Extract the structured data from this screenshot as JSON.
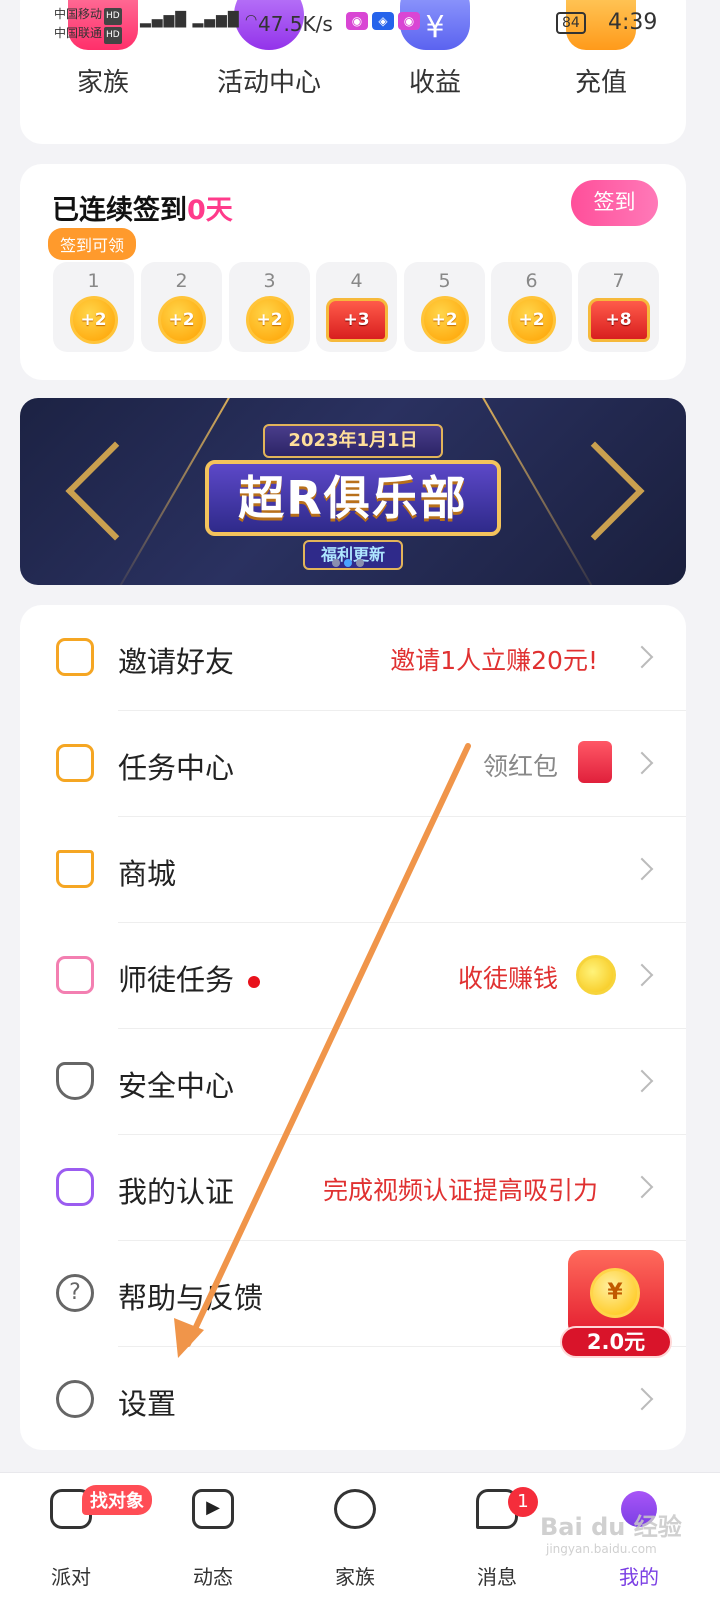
{
  "status_bar": {
    "carrier_1": "中国移动",
    "carrier_2": "中国联通",
    "hd_label": "HD",
    "net_speed": "47.5K/s",
    "battery": "84",
    "time": "4:39"
  },
  "quick_entries": [
    {
      "label": "家族",
      "icon": "family-icon",
      "color": "#ff4f7e"
    },
    {
      "label": "活动中心",
      "icon": "star-icon",
      "color": "#a855f7"
    },
    {
      "label": "收益",
      "icon": "money-bag-icon",
      "color": "#6d7cf6"
    },
    {
      "label": "充值",
      "icon": "lightning-icon",
      "color": "#ffa21a"
    }
  ],
  "checkin": {
    "title_prefix": "已连续签到",
    "days_value": "0天",
    "sign_button": "签到",
    "tip": "签到可领",
    "days": [
      {
        "num": "1",
        "reward": "+2",
        "kind": "coin"
      },
      {
        "num": "2",
        "reward": "+2",
        "kind": "coin"
      },
      {
        "num": "3",
        "reward": "+2",
        "kind": "coin"
      },
      {
        "num": "4",
        "reward": "+3",
        "kind": "chest"
      },
      {
        "num": "5",
        "reward": "+2",
        "kind": "coin"
      },
      {
        "num": "6",
        "reward": "+2",
        "kind": "coin"
      },
      {
        "num": "7",
        "reward": "+8",
        "kind": "chest"
      }
    ]
  },
  "banner": {
    "date": "2023年1月1日",
    "name": "超R俱乐部",
    "subtitle": "福利更新"
  },
  "menu": [
    {
      "label": "邀请好友",
      "right": "邀请1人立赚20元!",
      "icon": "gift-icon",
      "icon_color": "#f5a623"
    },
    {
      "label": "任务中心",
      "right": "领红包",
      "icon": "task-list-icon",
      "icon_color": "#f5a623"
    },
    {
      "label": "商城",
      "right": "",
      "icon": "shop-icon",
      "icon_color": "#f5a623"
    },
    {
      "label": "师徒任务",
      "right": "收徒赚钱",
      "icon": "mentor-icon",
      "icon_color": "#f37fb1"
    },
    {
      "label": "安全中心",
      "right": "",
      "icon": "shield-icon",
      "icon_color": "#666666"
    },
    {
      "label": "我的认证",
      "right": "完成视频认证提高吸引力",
      "icon": "verified-icon",
      "icon_color": "#9b5cf0"
    },
    {
      "label": "帮助与反馈",
      "right": "",
      "icon": "help-icon",
      "icon_color": "#666666"
    },
    {
      "label": "设置",
      "right": "",
      "icon": "settings-icon",
      "icon_color": "#666666"
    }
  ],
  "red_packet": {
    "symbol": "¥",
    "amount": "2.0元"
  },
  "bottom_nav": [
    {
      "label": "派对",
      "icon": "party-heart-icon"
    },
    {
      "label": "动态",
      "icon": "video-play-icon"
    },
    {
      "label": "家族",
      "icon": "family-people-icon"
    },
    {
      "label": "消息",
      "icon": "chat-icon"
    },
    {
      "label": "我的",
      "icon": "profile-icon"
    }
  ],
  "nav_pill": "找对象",
  "message_badge": "1",
  "watermark": "Bai du 经验",
  "watermark_url": "jingyan.baidu.com",
  "colors": {
    "accent_pink": "#ff3b8b",
    "alert_red": "#e03131",
    "active_purple": "#7b3fe4"
  }
}
